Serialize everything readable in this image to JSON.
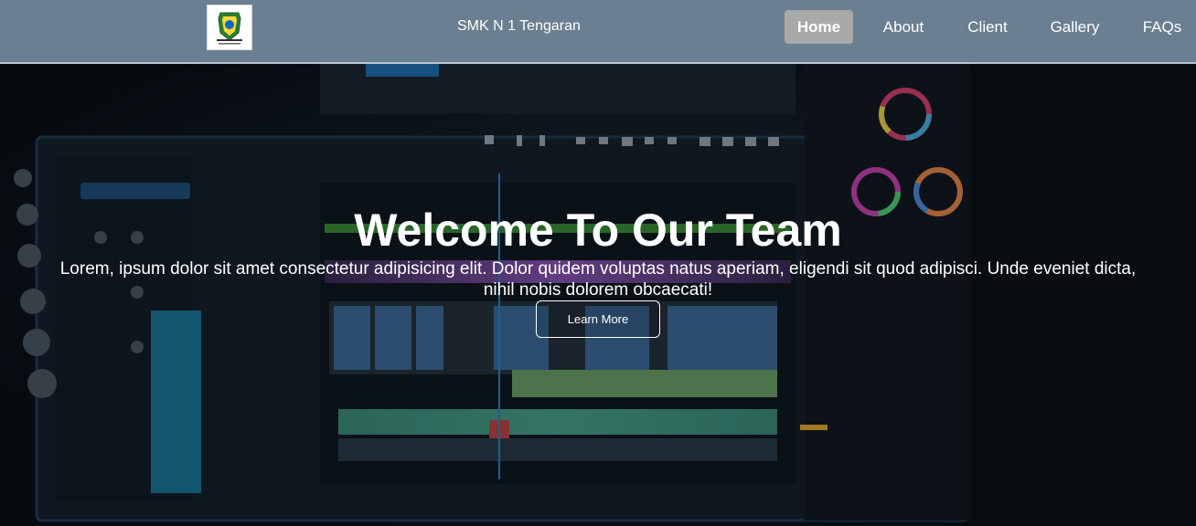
{
  "header": {
    "logo_icon": "school-crest-icon",
    "brand": "SMK N 1 Tengaran",
    "nav": [
      {
        "label": "Home",
        "active": true
      },
      {
        "label": "About",
        "active": false
      },
      {
        "label": "Client",
        "active": false
      },
      {
        "label": "Gallery",
        "active": false
      },
      {
        "label": "FAQs",
        "active": false
      }
    ]
  },
  "hero": {
    "title": "Welcome To Our Team",
    "text": "Lorem, ipsum dolor sit amet consectetur adipisicing elit. Dolor quidem voluptas natus aperiam, eligendi sit quod adipisci. Unde eveniet dicta, nihil nobis dolorem obcaecati!",
    "button": "Learn More"
  },
  "colors": {
    "navbar": "#6a7f91",
    "active_nav": "#a9a9a9"
  }
}
